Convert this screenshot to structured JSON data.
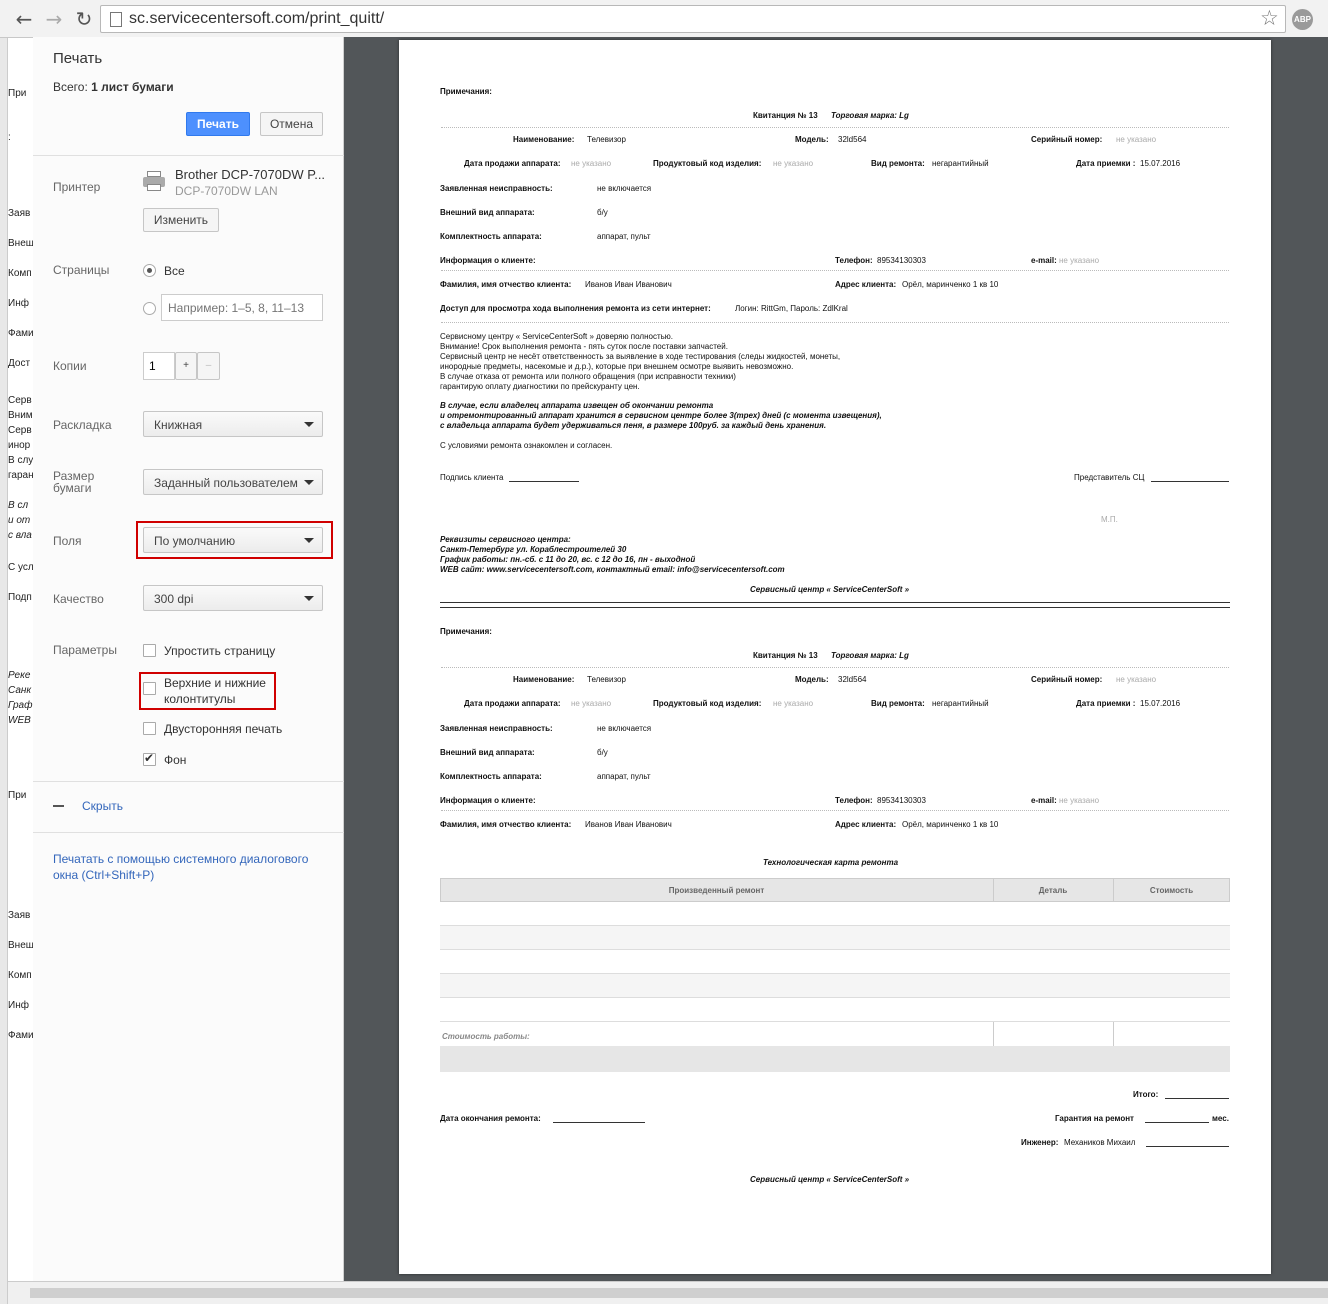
{
  "browser": {
    "url": "sc.servicecentersoft.com/print_quitt/",
    "back_icon": "back-arrow-icon",
    "forward_icon": "forward-arrow-icon",
    "reload_icon": "reload-icon",
    "star_icon": "bookmark-star-icon",
    "abp_label": "ABP"
  },
  "background_fragments": [
    "При",
    ":",
    "Заяв",
    "Внеш",
    "Комп",
    "Инф",
    "Фами",
    "Дост",
    "Серв",
    "Вним",
    "Серв",
    "инор",
    "В слу",
    "гаран",
    "В сл",
    "и от",
    "с вла",
    "С усл",
    "Подп",
    "Реке",
    "Санк",
    "Граф",
    "WEB",
    "При",
    "Заяв",
    "Внеш",
    "Комп",
    "Инф",
    "Фами"
  ],
  "dialog": {
    "title": "Печать",
    "total_prefix": "Всего:",
    "total_value": "1 лист бумаги",
    "print_button": "Печать",
    "cancel_button": "Отмена",
    "printer_label": "Принтер",
    "printer_name": "Brother DCP-7070DW P...",
    "printer_sub": "DCP-7070DW LAN",
    "change_button": "Изменить",
    "pages_label": "Страницы",
    "pages_all": "Все",
    "pages_placeholder": "Например: 1–5, 8, 11–13",
    "copies_label": "Копии",
    "copies_value": "1",
    "copies_plus": "+",
    "copies_minus": "–",
    "layout_label": "Раскладка",
    "layout_value": "Книжная",
    "paper_label": "Размер бумаги",
    "paper_value": "Заданный пользователем",
    "margins_label": "Поля",
    "margins_value": "По умолчанию",
    "quality_label": "Качество",
    "quality_value": "300 dpi",
    "options_label": "Параметры",
    "opt_simplify": "Упростить страницу",
    "opt_headers": "Верхние и нижние колонтитулы",
    "opt_duplex": "Двусторонняя печать",
    "opt_background": "Фон",
    "hide_link": "Скрыть",
    "system_dialog_link": "Печатать с помощью системного диалогового окна (Ctrl+Shift+P)"
  },
  "doc": {
    "notes": "Примечания:",
    "receipt": "Квитанция № 13",
    "brand": "Торговая марка: Lg",
    "name_label": "Наименование:",
    "name_value": "Телевизор",
    "model_label": "Модель:",
    "model_value": "32ld564",
    "serial_label": "Серийный номер:",
    "not_specified": "не указано",
    "sale_date_label": "Дата продажи аппарата:",
    "product_code_label": "Продуктовый код изделия:",
    "repair_type_label": "Вид ремонта:",
    "repair_type_value": "негарантийный",
    "intake_date_label": "Дата приемки :",
    "intake_date_value": "15.07.2016",
    "fault_label": "Заявленная неисправность:",
    "fault_value": "не включается",
    "appearance_label": "Внешний вид аппарата:",
    "appearance_value": "б/у",
    "kit_label": "Комплектность аппарата:",
    "kit_value": "аппарат, пульт",
    "client_info_label": "Информация о клиенте:",
    "phone_label": "Телефон:",
    "phone_value": "89534130303",
    "email_label": "e-mail:",
    "fio_label": "Фамилия, имя отчество клиента:",
    "fio_value": "Иванов Иван Иванович",
    "address_label": "Адрес клиента:",
    "address_value": "Орёл, маринченко 1 кв 10",
    "access_label": "Доступ для просмотра хода выполнения ремонта из сети интернет:",
    "access_value": "Логин: RittGm, Пароль: ZdlKral",
    "terms": [
      "Сервисному центру « ServiceCenterSoft » доверяю полностью.",
      "Внимание! Срок выполнения ремонта - пять суток после поставки запчастей.",
      "Сервисный центр не несёт ответственность за выявление в ходе тестирования (следы жидкостей, монеты,",
      "инородные предметы, насекомые и д.р.), которые при внешнем осмотре выявить невозможно.",
      "В случае отказа от ремонта или полного обращения (при исправности техники)",
      "гарантирую оплату диагностики по прейскуранту цен."
    ],
    "warning": [
      "В случае, если владелец аппарата извещен об окончании ремонта",
      "и отремонтированный аппарат хранится в сервисном центре более 3(трех) дней (с момента извещения),",
      "с владельца аппарата будет удерживаться пеня, в размере 100руб. за каждый день хранения."
    ],
    "agree": "С условиями ремонта ознакомлен и согласен.",
    "client_sign": "Подпись клиента",
    "rep_sign": "Представитель СЦ",
    "stamp": "М.П.",
    "requisites": [
      "Реквизиты сервисного центра:",
      "Санкт-Петербург ул. Кораблестроителей 30",
      "График работы: пн.-сб. с 11 до 20, вс. с 12 до 16, пн - выходной",
      "WEB сайт: www.servicecentersoft.com,    контактный email: info@servicecentersoft.com"
    ],
    "footer": "Сервисный центр « ServiceCenterSoft »",
    "tech_card": "Технологическая карта ремонта",
    "table_headers": [
      "Произведенный ремонт",
      "Деталь",
      "Стоимость"
    ],
    "work_cost": "Стоимость работы:",
    "total_label": "Итого:",
    "end_date_label": "Дата окончания ремонта:",
    "warranty_label": "Гарантия на ремонт",
    "warranty_unit": "мес.",
    "engineer_label": "Инженер:",
    "engineer_value": "Механиков Михаил"
  }
}
